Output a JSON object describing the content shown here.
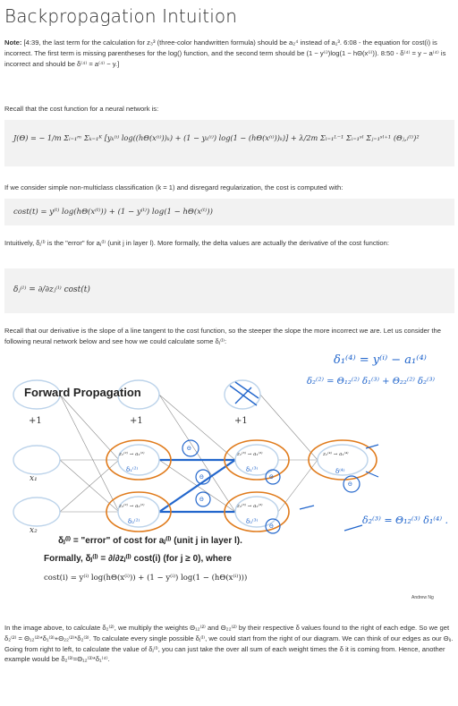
{
  "title": "Backpropagation Intuition",
  "note": {
    "label": "Note:",
    "text": "[4:39, the last term for the calculation for z₃³ (three-color handwritten formula) should be a₂⁴ instead of a₁³. 6:08 - the equation for cost(i) is incorrect. The first term is missing parentheses for the log() function, and the second term should be (1 − y⁽ⁱ⁾)log(1 − hΘ(x⁽ⁱ⁾)). 8:50 - δ⁽⁴⁾ = y − a⁽⁴⁾ is incorrect and should be δ⁽⁴⁾ = a⁽⁴⁾ − y.]"
  },
  "recall_cost": "Recall that the cost function for a neural network is:",
  "cost_formula": "J(Θ) = − 1/m Σᵢ₌₁ᵐ Σₖ₌₁ᴷ [yₖ⁽ⁱ⁾ log((hΘ(x⁽ⁱ⁾))ₖ) + (1 − yₖ⁽ⁱ⁾) log(1 − (hΘ(x⁽ⁱ⁾))ₖ)] + λ/2m Σₗ₌₁ᴸ⁻¹ Σᵢ₌₁ˢˡ Σⱼ₌₁ˢˡ⁺¹ (Θⱼ,ᵢ⁽ˡ⁾)²",
  "simple_case": "If we consider simple non-multiclass classification (k = 1) and disregard regularization, the cost is computed with:",
  "cost_i_formula": "cost(t) = y⁽ᵗ⁾ log(hΘ(x⁽ᵗ⁾)) + (1 − y⁽ᵗ⁾) log(1 − hΘ(x⁽ᵗ⁾))",
  "intuition": "Intuitively, δⱼ⁽ˡ⁾ is the \"error\" for aⱼ⁽ˡ⁾ (unit j in layer l). More formally, the delta values are actually the derivative of the cost function:",
  "delta_formula": "δⱼ⁽ˡ⁾ = ∂/∂zⱼ⁽ˡ⁾ cost(t)",
  "slope_text": "Recall that our derivative is the slope of a line tangent to the cost function, so the steeper the slope the more incorrect we are. Let us consider the following neural network below and see how we could calculate some δⱼ⁽ˡ⁾:",
  "figure": {
    "heading": "Forward Propagation",
    "bias_label": "+1",
    "inputs": [
      "x₁",
      "x₂"
    ],
    "hidden2": [
      "z₁⁽²⁾ → a₁⁽²⁾",
      "z₂⁽²⁾ → a₂⁽²⁾"
    ],
    "hidden3": [
      "z₁⁽³⁾ → a₁⁽³⁾",
      "z₂⁽³⁾ → a₂⁽³⁾"
    ],
    "output": "z₁⁽⁴⁾ → a₁⁽⁴⁾",
    "hand_delta4": "δ₁⁽⁴⁾ = y⁽ⁱ⁾ − a₁⁽⁴⁾",
    "hand_delta2": "δ₂⁽²⁾ = Θ₁₂⁽²⁾ δ₁⁽³⁾ + Θ₂₂⁽²⁾ δ₂⁽³⁾",
    "hand_delta3": "δ₂⁽³⁾ = Θ₁₂⁽³⁾ δ₁⁽⁴⁾ .",
    "hand_small": [
      "δ₁⁽²⁾",
      "δ₂⁽²⁾",
      "δ₁⁽³⁾",
      "δ₂⁽³⁾",
      "δ⁽⁴⁾"
    ],
    "def_line": "δⱼ⁽ˡ⁾ = \"error\" of cost for aⱼ⁽ˡ⁾ (unit j in layer l).",
    "formally_line": "Formally, δⱼ⁽ˡ⁾ = ∂/∂zⱼ⁽ˡ⁾ cost(i)  (for j ≥ 0), where",
    "cost_line": "cost(i) = y⁽ⁱ⁾ log(hΘ(x⁽ⁱ⁾)) + (1 − y⁽ⁱ⁾) log(1 − (hΘ(x⁽ⁱ⁾)))",
    "credit": "Andrew Ng"
  },
  "closing": "In the image above, to calculate δ₂⁽²⁾, we multiply the weights Θ₁₂⁽²⁾ and Θ₂₂⁽²⁾ by their respective δ values found to the right of each edge. So we get δ₂⁽²⁾ = Θ₁₂⁽²⁾*δ₁⁽³⁾+Θ₂₂⁽²⁾*δ₂⁽³⁾. To calculate every single possible δⱼ⁽ˡ⁾, we could start from the right of our diagram. We can think of our edges as our Θᵢⱼ. Going from right to left, to calculate the value of δⱼ⁽ˡ⁾, you can just take the over all sum of each weight times the δ it is coming from. Hence, another example would be δ₂⁽³⁾=Θ₁₂⁽³⁾*δ₁⁽⁴⁾."
}
